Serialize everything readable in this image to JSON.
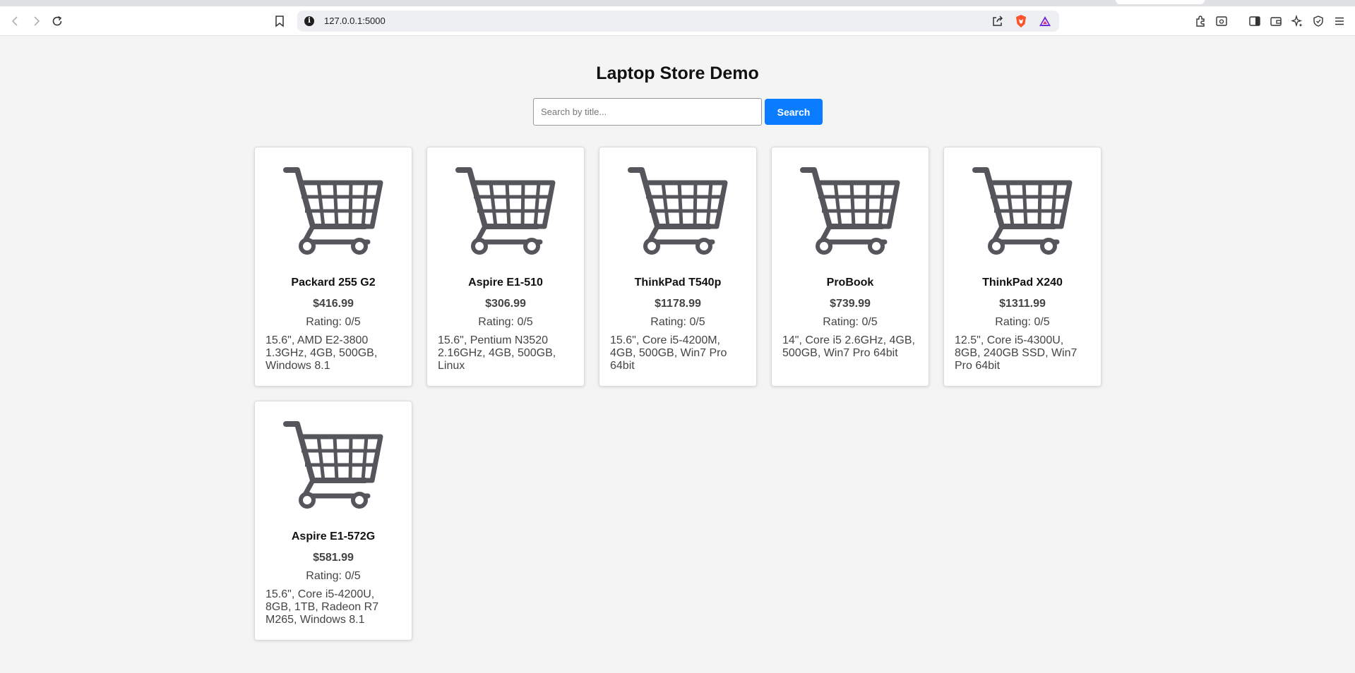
{
  "browser": {
    "url": "127.0.0.1:5000"
  },
  "page": {
    "title": "Laptop Store Demo",
    "search": {
      "placeholder": "Search by title...",
      "value": "",
      "button_label": "Search"
    }
  },
  "products": [
    {
      "name": "Packard 255 G2",
      "price": "$416.99",
      "rating": "Rating: 0/5",
      "description": "15.6\", AMD E2-3800 1.3GHz, 4GB, 500GB, Windows 8.1",
      "image_icon": "shopping-cart-icon"
    },
    {
      "name": "Aspire E1-510",
      "price": "$306.99",
      "rating": "Rating: 0/5",
      "description": "15.6\", Pentium N3520 2.16GHz, 4GB, 500GB, Linux",
      "image_icon": "shopping-cart-icon"
    },
    {
      "name": "ThinkPad T540p",
      "price": "$1178.99",
      "rating": "Rating: 0/5",
      "description": "15.6\", Core i5-4200M, 4GB, 500GB, Win7 Pro 64bit",
      "image_icon": "shopping-cart-icon"
    },
    {
      "name": "ProBook",
      "price": "$739.99",
      "rating": "Rating: 0/5",
      "description": "14\", Core i5 2.6GHz, 4GB, 500GB, Win7 Pro 64bit",
      "image_icon": "shopping-cart-icon"
    },
    {
      "name": "ThinkPad X240",
      "price": "$1311.99",
      "rating": "Rating: 0/5",
      "description": "12.5\", Core i5-4300U, 8GB, 240GB SSD, Win7 Pro 64bit",
      "image_icon": "shopping-cart-icon"
    },
    {
      "name": "Aspire E1-572G",
      "price": "$581.99",
      "rating": "Rating: 0/5",
      "description": "15.6\", Core i5-4200U, 8GB, 1TB, Radeon R7 M265, Windows 8.1",
      "image_icon": "shopping-cart-icon"
    }
  ],
  "colors": {
    "accent": "#0a7cff",
    "background": "#f4f4f4",
    "cart_icon": "#55555c"
  }
}
